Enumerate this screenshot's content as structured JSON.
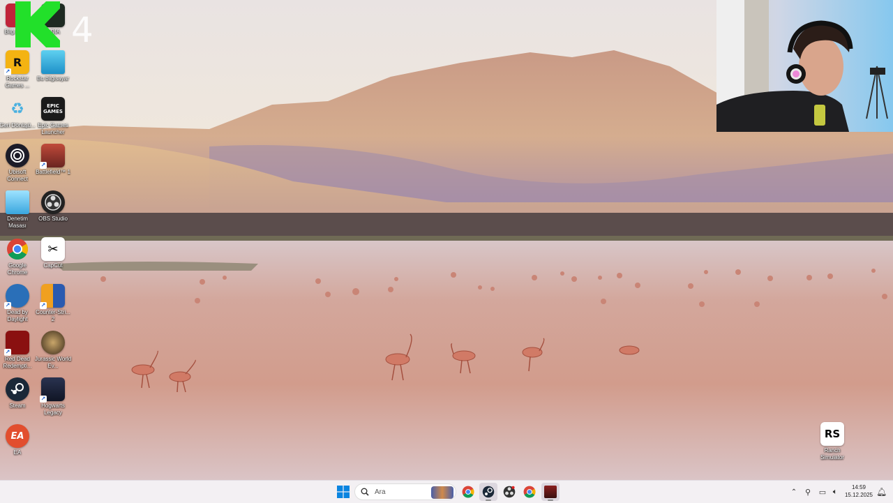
{
  "desktop": {
    "icons": [
      {
        "label": "Bilgi Oto...",
        "icon": "red-app-icon"
      },
      {
        "label": "...DIA",
        "icon": "nvidia-icon"
      },
      {
        "label": "Rockstar Games ...",
        "icon": "rockstar-icon"
      },
      {
        "label": "Bu bilgisayar",
        "icon": "computer-icon"
      },
      {
        "label": "Geri Dönüşü...",
        "icon": "recycle-bin-icon"
      },
      {
        "label": "Epic Games Launcher",
        "icon": "epic-games-icon",
        "text": "EPIC GAMES"
      },
      {
        "label": "Ubisoft Connect",
        "icon": "ubisoft-icon"
      },
      {
        "label": "Battlefield™ 1",
        "icon": "battlefield-icon"
      },
      {
        "label": "Denetim Masası",
        "icon": "control-panel-icon"
      },
      {
        "label": "OBS Studio",
        "icon": "obs-icon"
      },
      {
        "label": "Google Chrome",
        "icon": "chrome-icon"
      },
      {
        "label": "CapCut",
        "icon": "capcut-icon"
      },
      {
        "label": "Dead by Daylight",
        "icon": "dead-by-daylight-icon"
      },
      {
        "label": "Counter-Stri... 2",
        "icon": "counter-strike-icon"
      },
      {
        "label": "Red Dead Redempti...",
        "icon": "red-dead-icon"
      },
      {
        "label": "Jurassic World Ev...",
        "icon": "jurassic-world-icon"
      },
      {
        "label": "Steam",
        "icon": "steam-icon"
      },
      {
        "label": "Hogwarts Legacy",
        "icon": "hogwarts-icon"
      },
      {
        "label": "EA",
        "icon": "ea-icon",
        "text": "EA"
      }
    ],
    "right_icon": {
      "label": "Ranch Simulator",
      "icon": "ranch-simulator-icon",
      "text": "RS"
    },
    "overlay_number": "4"
  },
  "taskbar": {
    "search_placeholder": "Ara",
    "apps": [
      "game-thumbnail-icon",
      "chrome-icon",
      "steam-icon",
      "obs-icon",
      "chrome-icon",
      "game-app-icon"
    ],
    "time": "14:59",
    "date": "15.12.2025"
  },
  "colors": {
    "taskbar_bg": "#f3f0f3",
    "windows_blue": "#0078d4"
  }
}
